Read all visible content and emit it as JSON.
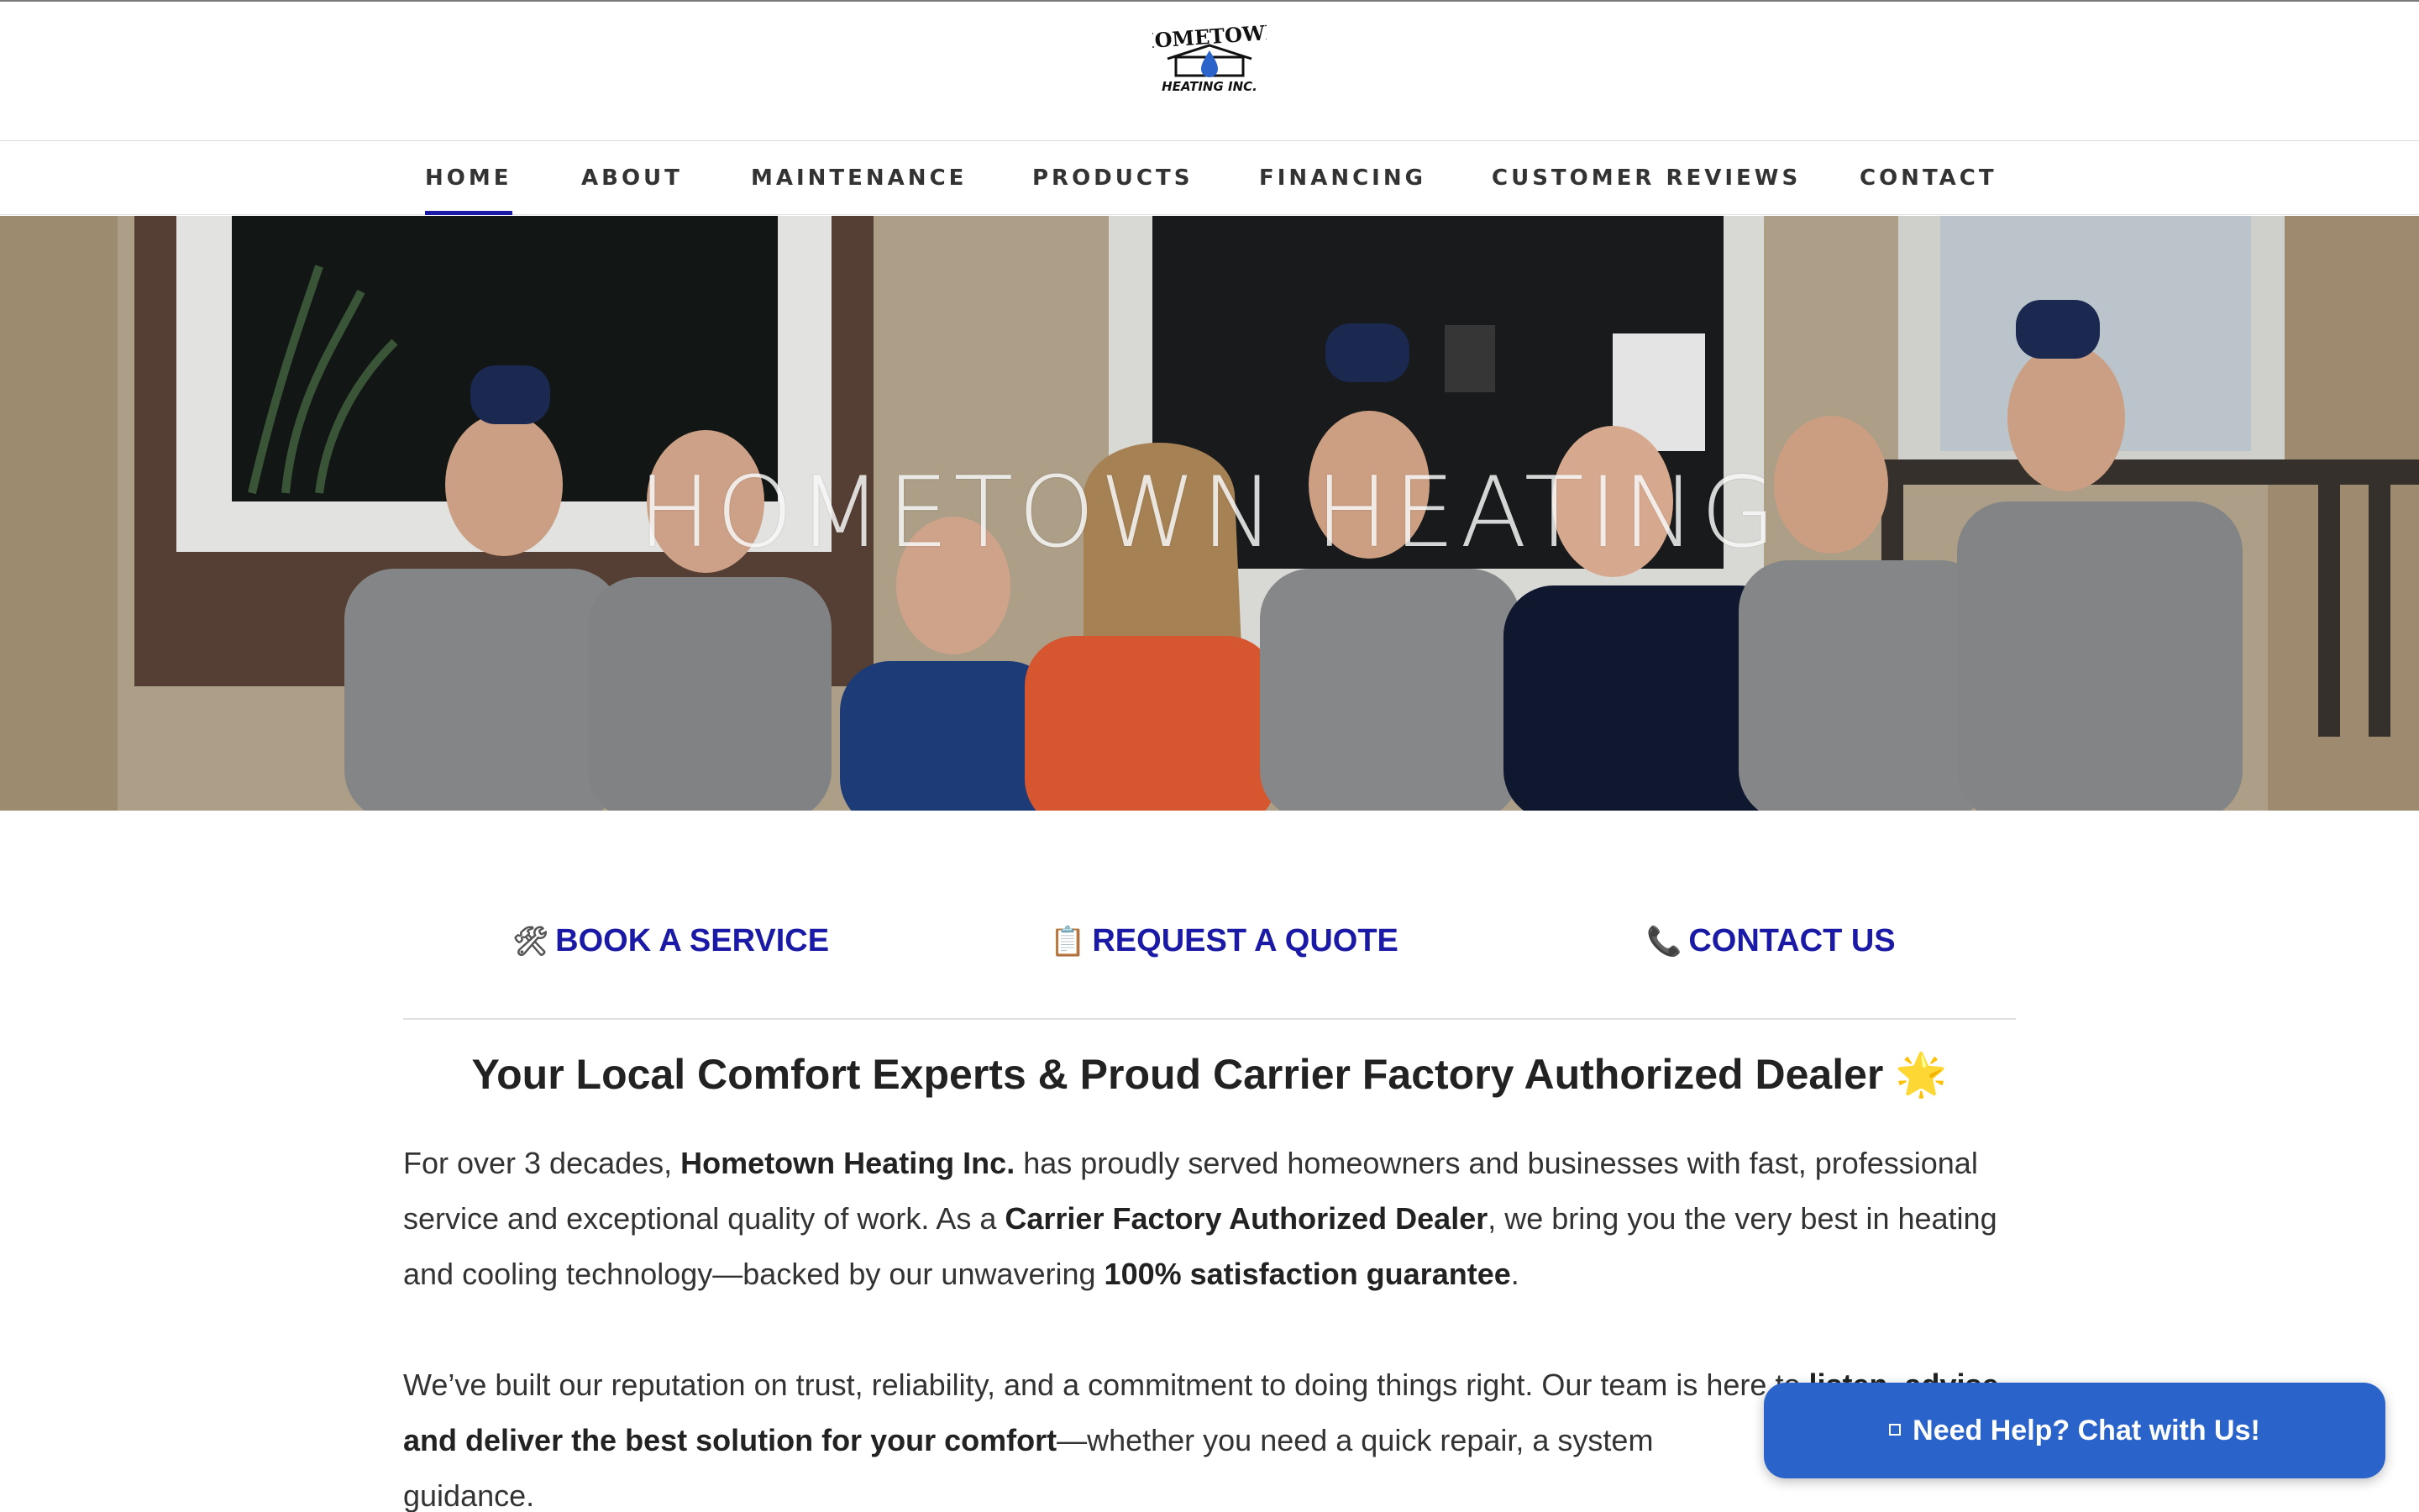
{
  "brand": {
    "logo_line1": "HOMETOWN",
    "logo_line2": "HEATING INC."
  },
  "nav": {
    "items": [
      {
        "label": "HOME",
        "active": true
      },
      {
        "label": "ABOUT"
      },
      {
        "label": "MAINTENANCE"
      },
      {
        "label": "PRODUCTS"
      },
      {
        "label": "FINANCING"
      },
      {
        "label": "CUSTOMER REVIEWS"
      },
      {
        "label": "CONTACT"
      }
    ],
    "active_color": "#1a1aa6"
  },
  "hero": {
    "title": "HOMETOWN HEATING"
  },
  "cta": {
    "book": {
      "emoji": "🛠",
      "label": "BOOK A SERVICE"
    },
    "quote": {
      "emoji": "📋",
      "label": "REQUEST A QUOTE"
    },
    "contact": {
      "emoji": "📞",
      "label": "CONTACT US"
    },
    "color": "#1a1aa6"
  },
  "intro": {
    "headline": "Your Local Comfort Experts & Proud Carrier Factory Authorized Dealer",
    "headline_emoji": "🌟",
    "p1": {
      "t1": "For over 3 decades, ",
      "b1": "Hometown Heating Inc.",
      "t2": " has proudly served homeowners and businesses with fast, professional service and exceptional quality of work. As a ",
      "b2": "Carrier Factory Authorized Dealer",
      "t3": ", we bring you the very best in heating and cooling technology—backed by our unwavering ",
      "b3": "100% satisfaction guarantee",
      "t4": "."
    },
    "p2": {
      "t1": "We’ve built our reputation on trust, reliability, and a commitment to doing things right. Our team is here to ",
      "b1": "listen, advise, and deliver the best solution for your comfort",
      "t2": "—whether you need a quick repair, a system ",
      "t3": "guidance."
    }
  },
  "chat": {
    "label": "Need Help? Chat with Us!",
    "color": "#2a63c9"
  }
}
